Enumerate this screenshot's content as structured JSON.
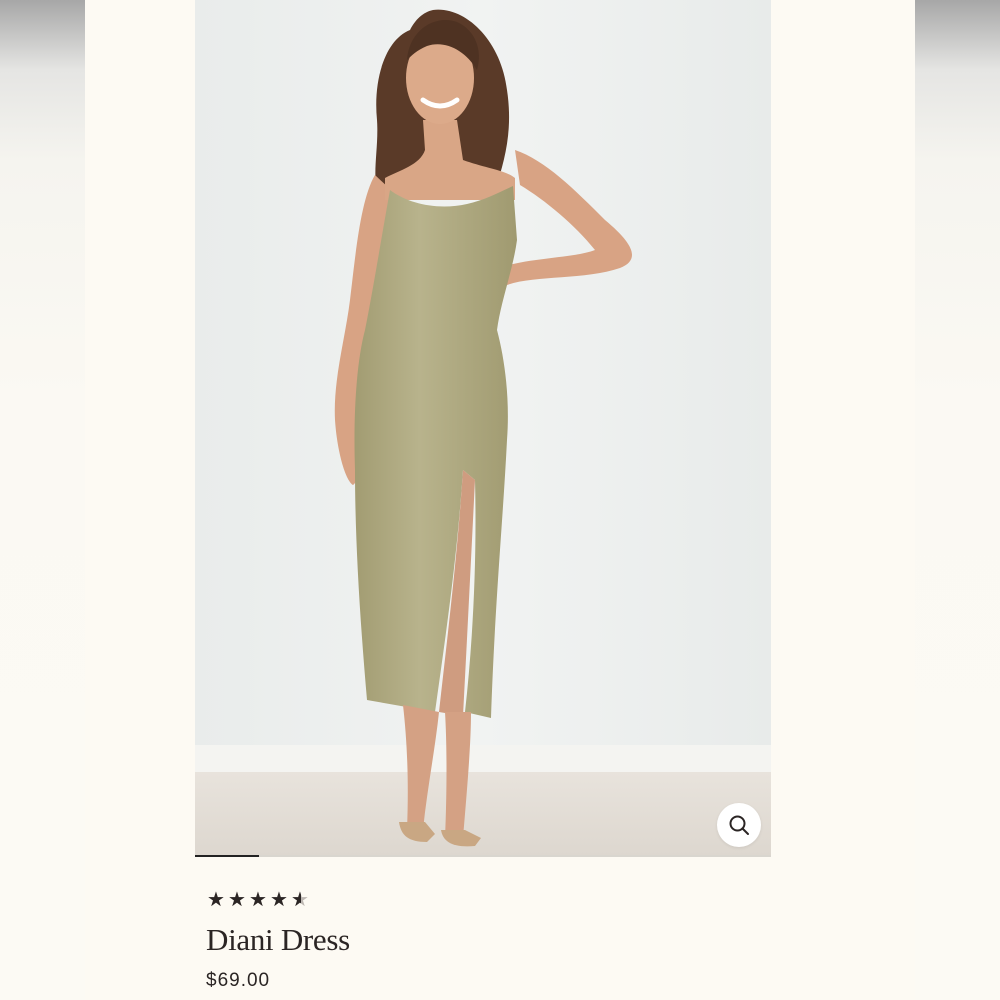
{
  "product": {
    "name": "Diani Dress",
    "price": "$69.00",
    "rating": {
      "value": 4.5,
      "max": 5
    },
    "image": {
      "icon": "product-photo",
      "dress_color": "#b2ad86",
      "background_color": "#ecefee"
    }
  },
  "gallery": {
    "zoom_icon": "magnifier-icon",
    "current_slide": 1
  }
}
